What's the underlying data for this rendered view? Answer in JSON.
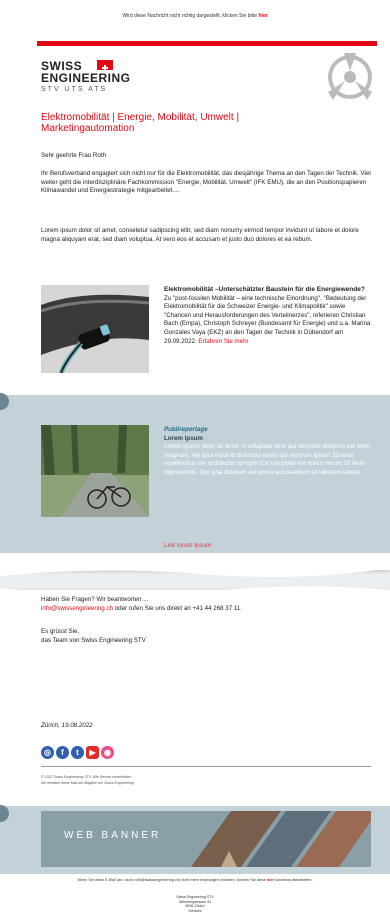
{
  "preheader": {
    "text": "Wird diese Nachricht nicht richtig dargestellt, klicken Sie bitte ",
    "link": "hier"
  },
  "logo": {
    "line1": "SWISS",
    "line2": "ENGINEERING",
    "line3": "STV  UTS  ATS"
  },
  "title": "Elektromobilität | Energie, Mobilität, Umwelt | Marketingautomation",
  "greeting": "Sehr geehrte Frau Roth",
  "intro": "Ihr Berufsverband engagiert sich nicht nur für die Elektromobilität, das diesjährige Thema an den Tagen der Technik. Viel weiter geht die interdisziplinäre Fachkommission \"Energie, Mobilität, Umwelt\" (IFK EMU), die an den Positionspapieren Klimawandel und Energiestrategie mitgearbeitet....",
  "lorem": "Lorem ipsum dolor sit amet, consetetur sadipscing elitr, sed diam nonumy eirmod tempor invidunt ut labore et dolore magna aliquyam erat, sed diam voluptua. At vero eos et accusam et justo duo dolores et ea rebum.",
  "article1": {
    "heading": "Elektromobilität –Unterschätzter Baustein für die Energiewende?",
    "body": "Zu \"post-fossilen Mobilität – eine technische Einordnung\", \"Bedeutung der Elektromobilität für die Schweizer Energie- und Klimapolitik\" sowie \"Chancen und Herausforderungen des Verteilnerzes\", referieren Christian Bach (Empa), Christoph Schreyer (Bundesamt für Energie) und u.a. Marina Gonzales Vaya (EKZ) an den Tagen der Technik in Dübendorf am 29.09.2022. ",
    "link": "Erfahren Sie mehr"
  },
  "article2": {
    "kicker": "Publireportage",
    "heading": "Lorem ipsum",
    "body": "Lorem ipsum dolor sit amet. A voluptate vero aut tempore dolorem est enim magnam. Vel ipsa modi id distinctio nemo qui nostrum ipsum 33 esse repellendus vel architecto corrupti! Est voluptate est minus rerum 33 illum dignissimos. Qui ipsa dolorem aut porro accusantium sit laborum labore.",
    "link": "Link lorum Ipsum"
  },
  "contact": {
    "question": "Haben Sie Fragen? Wir beantworten ...",
    "email": "info@swissengineering.ch",
    "phone_text": " oder rufen Sie uns direkt an +41 44 268 37 11."
  },
  "signoff": {
    "line1": "Es grüsst Sie,",
    "line2": "das Team von Swiss Engineering STV"
  },
  "date": "Zürich, 19.08.2022",
  "footer": {
    "copyright": "© 2022 Swiss Engineering STV. Alle Rechte vorbehalten.",
    "membership": "Sie erhalten diese Mail als Mitglied von Swiss Engineering",
    "banner": "WEB BANNER",
    "unsubscribe": "Wenn Sie diese E-Mail (an: uschi.roth@swissengineering.ch) nicht mehr empfangen möchten, können Sie diese ",
    "unsubscribe_link": "hier",
    "unsubscribe_end": " kostenlos abbestellen.",
    "address": [
      "Swiss Engineering STV",
      "Weinbergstrasse 41",
      "8006 Zürich",
      "Schweiz",
      "",
      "+41 41 268 37 11",
      "info@swissengineering.ch",
      "www.swissengineering.ch"
    ]
  },
  "social_icons": [
    "instagram-icon",
    "facebook-icon",
    "twitter-icon",
    "youtube-icon",
    "dribbble-icon"
  ],
  "colors": {
    "accent": "#e30613",
    "band": "#c3d1d8",
    "kicker": "#1f6e8c"
  }
}
